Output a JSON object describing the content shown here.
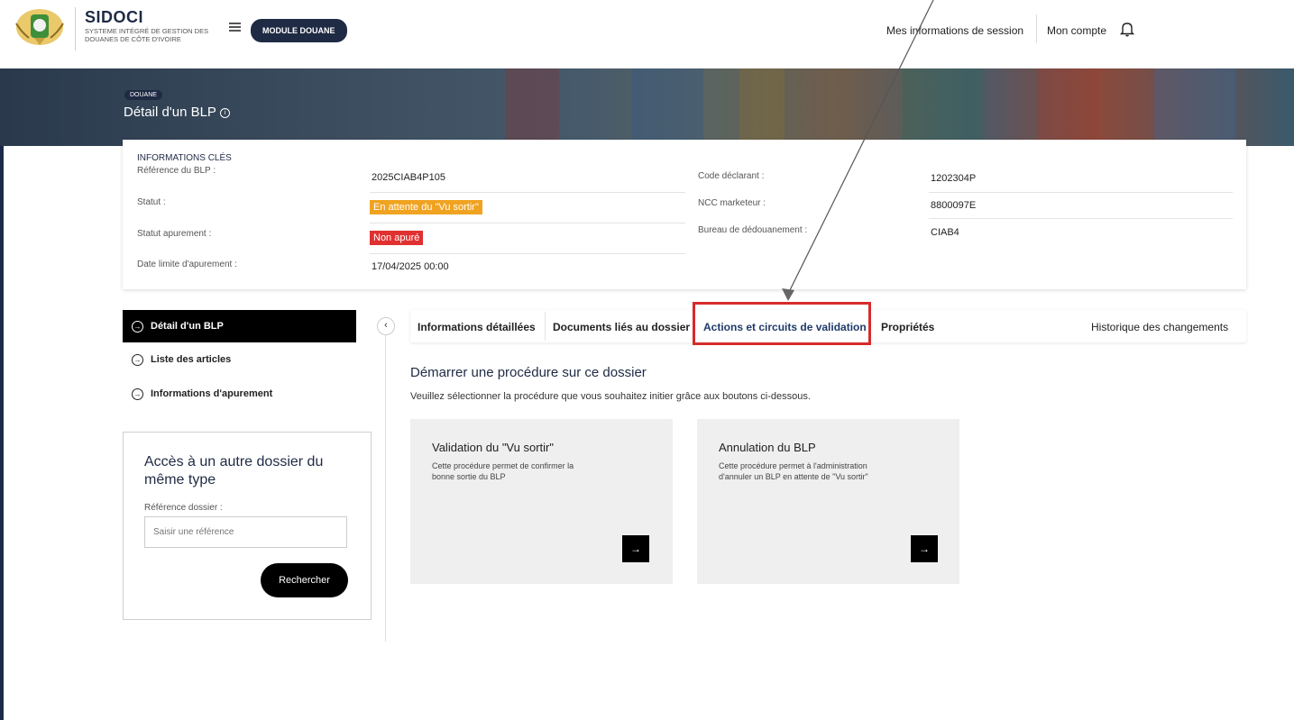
{
  "header": {
    "brand_name": "SIDOCI",
    "brand_sub": "SYSTEME INTÉGRÉ DE GESTION DES DOUANES DE CÔTE D'IVOIRE",
    "module_label": "MODULE DOUANE",
    "session_link": "Mes informations de session",
    "account_link": "Mon compte"
  },
  "banner": {
    "badge": "DOUANE",
    "title": "Détail d'un BLP",
    "info_symbol": "i"
  },
  "key_info": {
    "title": "INFORMATIONS CLÉS",
    "left": [
      {
        "label": "Référence du BLP :",
        "value": "2025CIAB4P105"
      },
      {
        "label": "Statut :",
        "value": "En attente du \"Vu sortir\""
      },
      {
        "label": "Statut apurement :",
        "value": "Non apuré"
      },
      {
        "label": "Date limite d'apurement :",
        "value": "17/04/2025 00:00"
      }
    ],
    "right": [
      {
        "label": "Code déclarant :",
        "value": "1202304P"
      },
      {
        "label": "NCC marketeur :",
        "value": "8800097E"
      },
      {
        "label": "Bureau de dédouanement :",
        "value": "CIAB4"
      }
    ]
  },
  "sidebar": {
    "items": [
      {
        "label": "Détail d'un BLP"
      },
      {
        "label": "Liste des articles"
      },
      {
        "label": "Informations d'apurement"
      }
    ],
    "collapse_symbol": "‹",
    "other": {
      "title": "Accès à un autre dossier du même type",
      "label": "Référence dossier :",
      "placeholder": "Saisir une référence",
      "button": "Rechercher"
    }
  },
  "tabs": {
    "items": [
      {
        "label": "Informations détaillées"
      },
      {
        "label": "Documents liés au dossier"
      },
      {
        "label": "Actions et circuits de validation"
      },
      {
        "label": "Propriétés"
      }
    ],
    "right": "Historique des changements"
  },
  "main": {
    "title": "Démarrer une procédure sur ce dossier",
    "subtitle": "Veuillez sélectionner la procédure que vous souhaitez initier grâce aux boutons ci-dessous.",
    "procedures": [
      {
        "title": "Validation du \"Vu sortir\"",
        "desc": "Cette procédure permet de confirmer la bonne sortie du BLP",
        "go": "→"
      },
      {
        "title": "Annulation du BLP",
        "desc": "Cette procédure permet à l'administration d'annuler un BLP en attente de \"Vu sortir\"",
        "go": "→"
      }
    ]
  },
  "colors": {
    "navy": "#1f2a44",
    "orange_badge": "#f0a320",
    "red_badge": "#e03030",
    "highlight": "#d62b2b"
  }
}
